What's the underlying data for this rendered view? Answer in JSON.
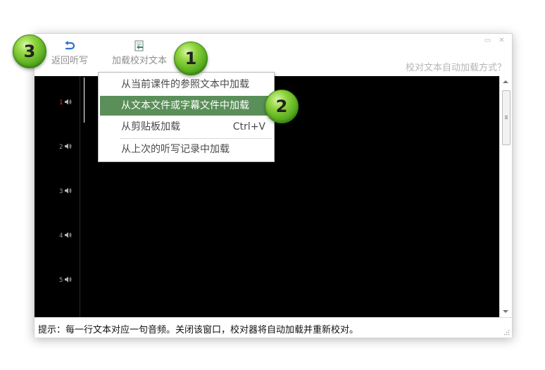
{
  "toolbar": {
    "back_label": "返回听写",
    "load_label": "加载校对文本",
    "help_link": "校对文本自动加载方式？"
  },
  "menu": {
    "items": [
      {
        "label": "从当前课件的参照文本中加载",
        "shortcut": ""
      },
      {
        "label": "从文本文件或字幕文件中加载",
        "shortcut": ""
      },
      {
        "label": "从剪贴板加载",
        "shortcut": "Ctrl+V"
      },
      {
        "label": "从上次的听写记录中加载",
        "shortcut": ""
      }
    ],
    "selected_index": 1
  },
  "editor": {
    "line_numbers": [
      "1",
      "2",
      "3",
      "4",
      "5"
    ],
    "active_line": "1"
  },
  "status": {
    "hint": "提示：每一行文本对应一句音频。关闭该窗口，校对器将自动加载并重新校对。"
  },
  "annotations": {
    "badge_1": "1",
    "badge_2": "2",
    "badge_3": "3"
  },
  "colors": {
    "menu_highlight": "#5a8f59",
    "badge_green": "#6cc02a",
    "active_line_number": "#e03030",
    "editor_background": "#000000"
  },
  "icons": {
    "back": "undo-arrow-icon",
    "load": "document-load-icon",
    "line": "speaker-icon"
  }
}
